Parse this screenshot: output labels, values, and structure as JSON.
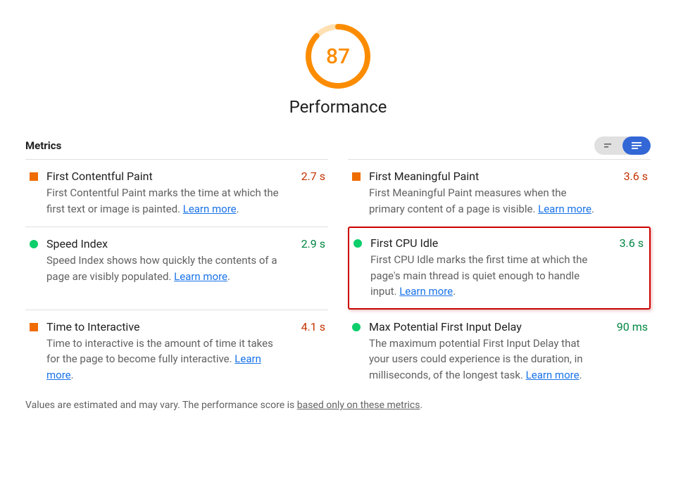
{
  "score": "87",
  "category": "Performance",
  "sectionTitle": "Metrics",
  "learnMoreText": "Learn more",
  "metrics": [
    {
      "title": "First Contentful Paint",
      "desc": "First Contentful Paint marks the time at which the first text or image is painted. ",
      "value": "2.7 s",
      "status": "average"
    },
    {
      "title": "First Meaningful Paint",
      "desc": "First Meaningful Paint measures when the primary content of a page is visible. ",
      "value": "3.6 s",
      "status": "average"
    },
    {
      "title": "Speed Index",
      "desc": "Speed Index shows how quickly the contents of a page are visibly populated. ",
      "value": "2.9 s",
      "status": "pass"
    },
    {
      "title": "First CPU Idle",
      "desc": "First CPU Idle marks the first time at which the page's main thread is quiet enough to handle input. ",
      "value": "3.6 s",
      "status": "pass",
      "highlight": true
    },
    {
      "title": "Time to Interactive",
      "desc": "Time to interactive is the amount of time it takes for the page to become fully interactive. ",
      "value": "4.1 s",
      "status": "average"
    },
    {
      "title": "Max Potential First Input Delay",
      "desc": "The maximum potential First Input Delay that your users could experience is the duration, in milliseconds, of the longest task. ",
      "value": "90 ms",
      "status": "pass"
    }
  ],
  "footer": {
    "prefix": "Values are estimated and may vary. The performance score is ",
    "link": "based only on these metrics",
    "suffix": "."
  }
}
